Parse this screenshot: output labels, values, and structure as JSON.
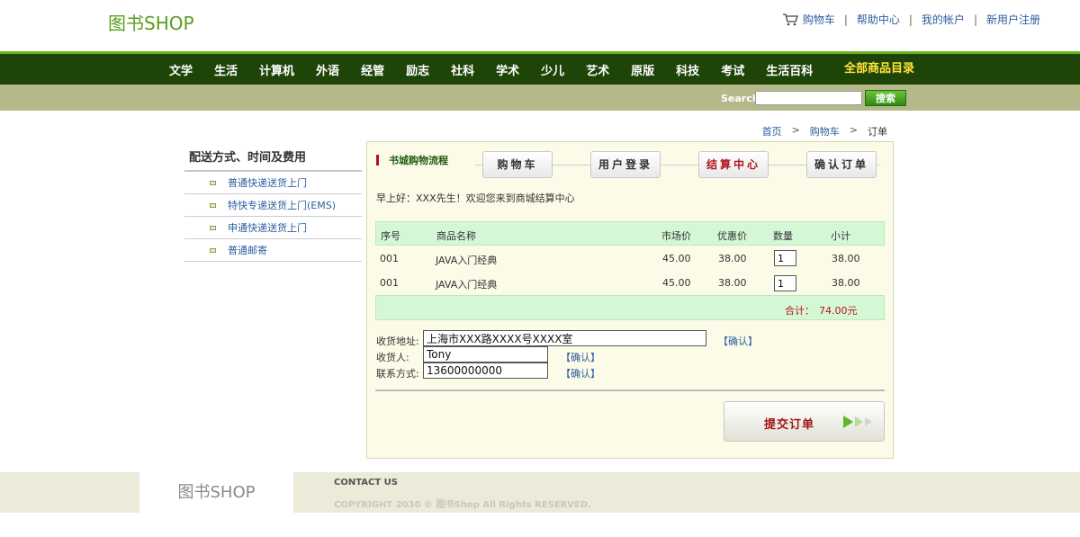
{
  "header": {
    "logo": "图书SHOP",
    "links": {
      "cart": "购物车",
      "help": "帮助中心",
      "account": "我的帐户",
      "register": "新用户注册"
    },
    "separator": "|"
  },
  "nav": {
    "items": [
      "文学",
      "生活",
      "计算机",
      "外语",
      "经管",
      "励志",
      "社科",
      "学术",
      "少儿",
      "艺术",
      "原版",
      "科技",
      "考试",
      "生活百科"
    ],
    "all": "全部商品目录"
  },
  "search": {
    "label": "Search",
    "value": "",
    "button": "搜索"
  },
  "breadcrumb": {
    "home": "首页",
    "cart": "购物车",
    "current": "订单",
    "arrow": ">"
  },
  "shipping": {
    "title": "配送方式、时间及费用",
    "items": [
      "普通快递送货上门",
      "特快专递送货上门(EMS)",
      "申通快递送货上门",
      "普通邮寄"
    ]
  },
  "flow": {
    "title": "书城购物流程",
    "steps": [
      "购物车",
      "用户登录",
      "结算中心",
      "确认订单"
    ],
    "active_step": "结算中心"
  },
  "welcome": "早上好：XXX先生！欢迎您来到商城结算中心",
  "table": {
    "headers": [
      "序号",
      "商品名称",
      "市场价",
      "优惠价",
      "数量",
      "小计"
    ],
    "rows": [
      {
        "id": "001",
        "name": "JAVA入门经典",
        "market": "45.00",
        "price": "38.00",
        "qty": "1",
        "subtotal": "38.00"
      },
      {
        "id": "001",
        "name": "JAVA入门经典",
        "market": "45.00",
        "price": "38.00",
        "qty": "1",
        "subtotal": "38.00"
      }
    ],
    "total_label": "合计：",
    "total_value": "74.00元"
  },
  "form": {
    "address_label": "收货地址:",
    "address_value": "上海市XXX路XXXX号XXXX室",
    "receiver_label": "收货人:",
    "receiver_value": "Tony",
    "phone_label": "联系方式:",
    "phone_value": "13600000000",
    "confirm": "【确认】"
  },
  "submit": "提交订单",
  "footer": {
    "logo": "图书SHOP",
    "contact": "CONTACT US",
    "copyright": "COPYRIGHT 2030 © 图书Shop All Rights RESERVED."
  },
  "colors": {
    "nav_bg": "#1e4407",
    "accent_green": "#6bb31e",
    "search_bar": "#b5b98a",
    "table_head": "#d4f7d6",
    "panel_bg": "#fbfbe8",
    "alert_red": "#c0121b"
  }
}
